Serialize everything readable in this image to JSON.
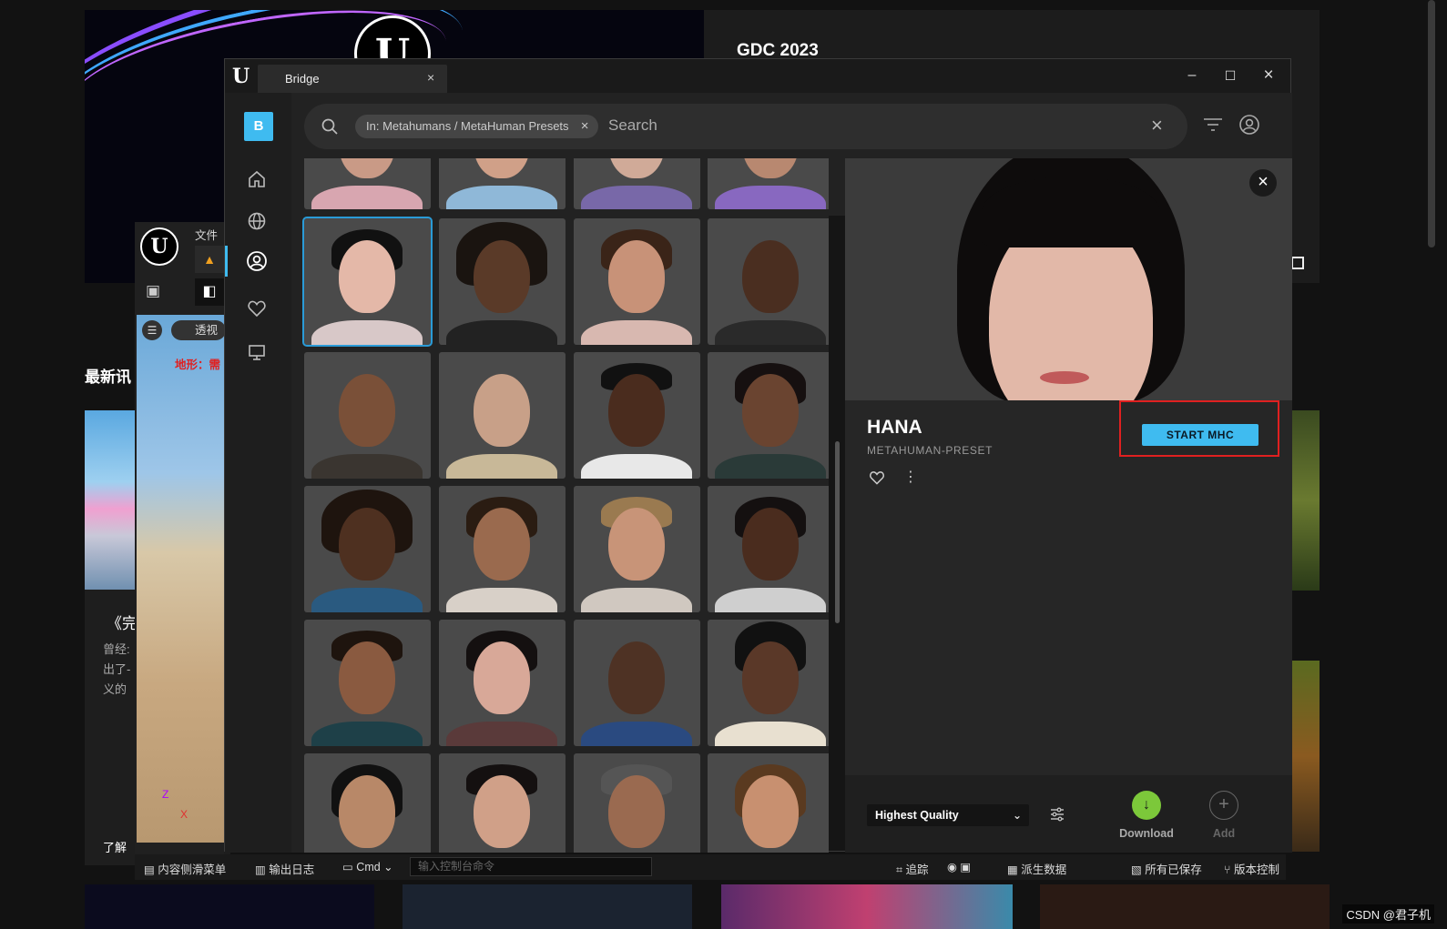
{
  "background_page": {
    "hero_title": "GDC 2023",
    "section_label": "最新讯",
    "article_title_fragment": "《完",
    "article_lines": [
      "曾经:",
      "出了-",
      "义的"
    ],
    "footer_link": "了解"
  },
  "ue_editor": {
    "menu_file": "文件",
    "viewport_mode": "透视",
    "terrain_warning": "地形：需",
    "statusbar": {
      "content_drawer": "内容侧滑菜单",
      "output_log": "输出日志",
      "cmd": "Cmd",
      "console_placeholder": "输入控制台命令",
      "trace": "追踪",
      "derived_data": "派生数据",
      "all_saved": "所有已保存",
      "source_control": "版本控制"
    },
    "axis": {
      "x": "X",
      "z": "Z"
    }
  },
  "bridge": {
    "tab_title": "Bridge",
    "search": {
      "filter_chip": "In: Metahumans / MetaHuman Presets",
      "placeholder": "Search"
    },
    "detail": {
      "name": "HANA",
      "subtitle": "METAHUMAN-PRESET",
      "start_button": "START MHC",
      "quality_select": "Highest Quality",
      "download_label": "Download",
      "add_label": "Add"
    },
    "colors": {
      "accent": "#3fbbf0",
      "download_green": "#7cc83a",
      "highlight_red": "#e02020",
      "selection_blue": "#2a9bd7"
    }
  },
  "watermark": "CSDN @君子机"
}
